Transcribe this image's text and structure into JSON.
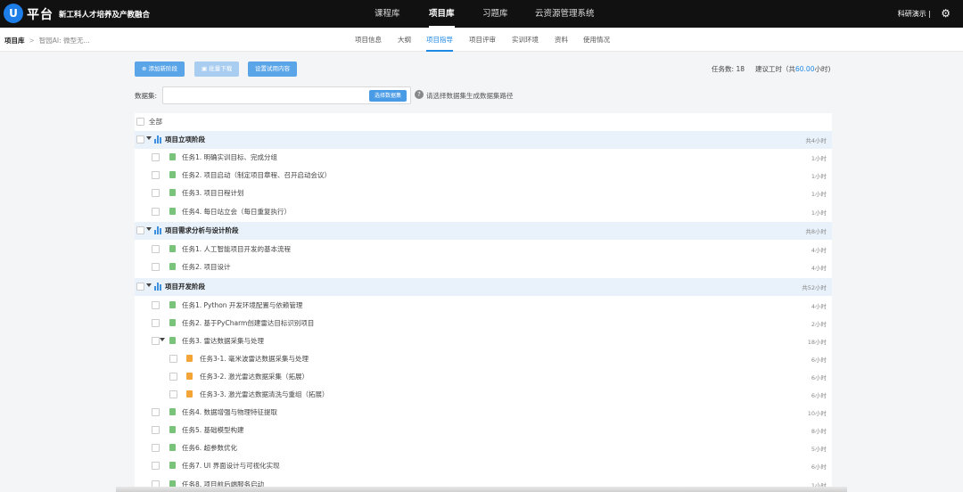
{
  "header": {
    "logo_letter": "U",
    "brand": "平台",
    "platform_title": "新工科人才培养及产教融合",
    "nav": [
      "课程库",
      "项目库",
      "习题库",
      "云资源管理系统"
    ],
    "user": "科研演示 |"
  },
  "breadcrumb": {
    "root": "项目库",
    "sep": ">",
    "current": "智园AI: 微型无..."
  },
  "tabs": [
    "项目信息",
    "大纲",
    "项目指导",
    "项目评审",
    "实训环境",
    "资料",
    "使用情况"
  ],
  "toolbar": {
    "add_phase": "添加新阶段",
    "batch_download": "批量下载",
    "trial_content": "设置试用内容",
    "task_count": "任务数: 18",
    "suggested_hours_prefix": "建议工时（共",
    "suggested_hours_value": "60.00",
    "suggested_hours_suffix": "小时)"
  },
  "dataset": {
    "label": "数据集:",
    "button": "选择数据集",
    "help": "请选择数据集生成数据集路径"
  },
  "list": {
    "select_all": "全部",
    "rows": [
      {
        "kind": "phase",
        "text": "项目立项阶段",
        "hours": "共4小时"
      },
      {
        "kind": "task",
        "text": "任务1. 明确实训目标、完成分组",
        "hours": "1小时"
      },
      {
        "kind": "task",
        "text": "任务2. 项目启动（制定项目章程、召开启动会议）",
        "hours": "1小时"
      },
      {
        "kind": "task",
        "text": "任务3. 项目日程计划",
        "hours": "1小时"
      },
      {
        "kind": "task",
        "text": "任务4. 每日站立会（每日重复执行）",
        "hours": "1小时"
      },
      {
        "kind": "phase",
        "text": "项目需求分析与设计阶段",
        "hours": "共8小时"
      },
      {
        "kind": "task",
        "text": "任务1. 人工智能项目开发的基本流程",
        "hours": "4小时"
      },
      {
        "kind": "task",
        "text": "任务2. 项目设计",
        "hours": "4小时"
      },
      {
        "kind": "phase",
        "text": "项目开发阶段",
        "hours": "共52小时"
      },
      {
        "kind": "task",
        "text": "任务1. Python 开发环境配置与依赖管理",
        "hours": "4小时"
      },
      {
        "kind": "task",
        "text": "任务2. 基于PyCharm创建雷达目标识别项目",
        "hours": "2小时"
      },
      {
        "kind": "task-expand",
        "text": "任务3. 雷达数据采集与处理",
        "hours": "18小时"
      },
      {
        "kind": "subtask",
        "text": "任务3-1. 毫米波雷达数据采集与处理",
        "hours": "6小时"
      },
      {
        "kind": "subtask",
        "text": "任务3-2. 激光雷达数据采集（拓展）",
        "hours": "6小时"
      },
      {
        "kind": "subtask",
        "text": "任务3-3. 激光雷达数据清洗与重组（拓展）",
        "hours": "6小时"
      },
      {
        "kind": "task",
        "text": "任务4. 数据增强与物理特征提取",
        "hours": "10小时"
      },
      {
        "kind": "task",
        "text": "任务5. 基础模型构建",
        "hours": "8小时"
      },
      {
        "kind": "task",
        "text": "任务6. 超参数优化",
        "hours": "5小时"
      },
      {
        "kind": "task",
        "text": "任务7. UI 界面设计与可视化实现",
        "hours": "6小时"
      },
      {
        "kind": "task",
        "text": "任务8. 项目前后端服务启动",
        "hours": "1小时"
      }
    ]
  },
  "colors": {
    "accent": "#1e88e5",
    "phase_bg": "#e9f2fb",
    "task_icon": "#79c47a",
    "subtask_icon": "#f3a53a"
  }
}
